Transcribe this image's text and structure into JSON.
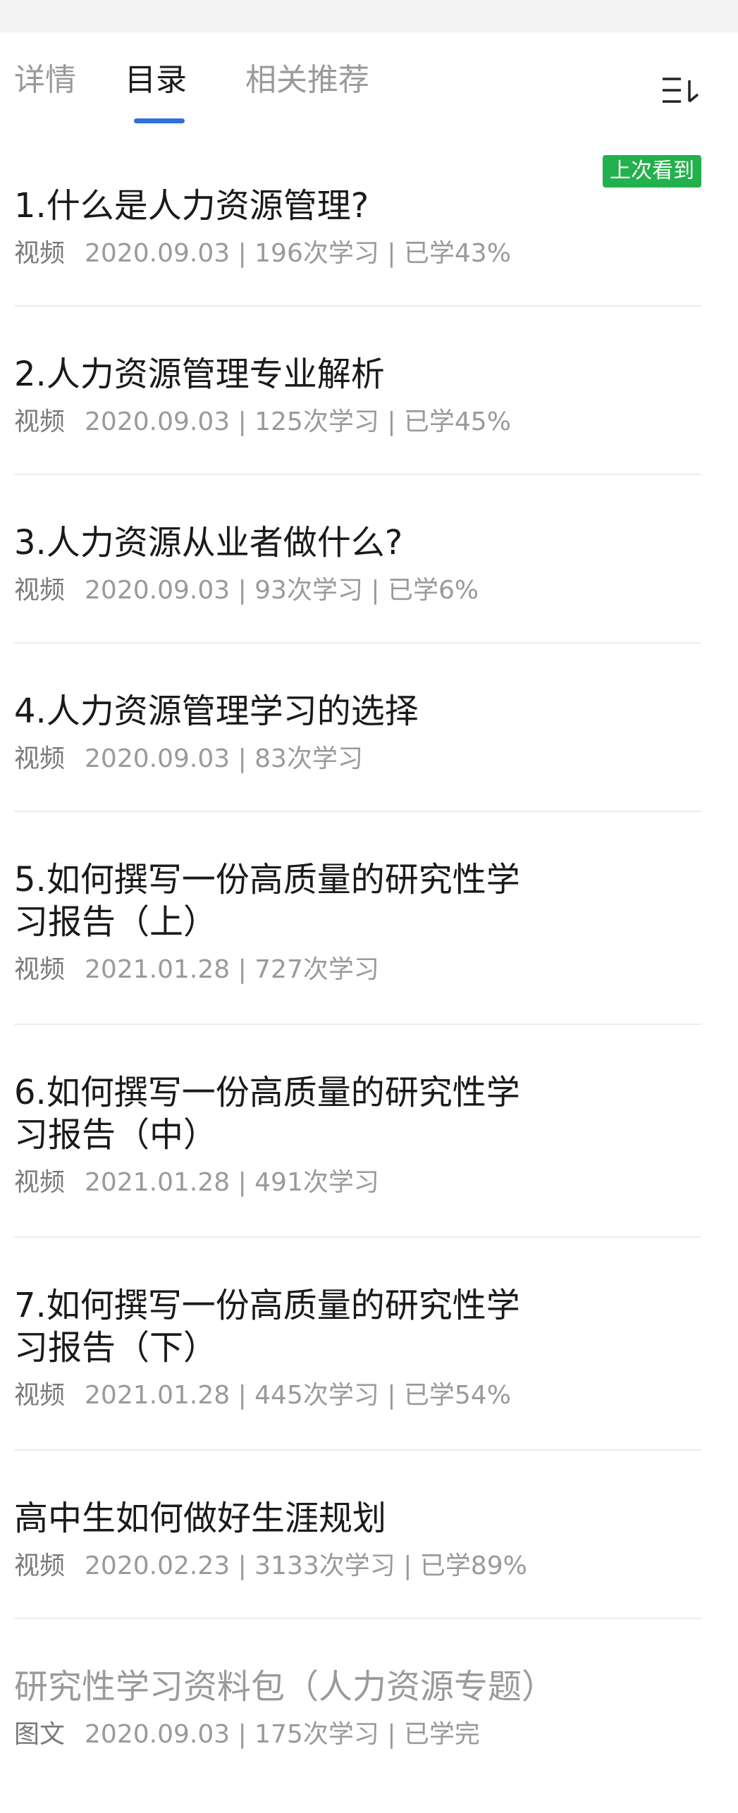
{
  "tabs": [
    {
      "label": "详情"
    },
    {
      "label": "目录"
    },
    {
      "label": "相关推荐"
    }
  ],
  "active_tab": "目录",
  "badge_last_viewed": "上次看到",
  "colors": {
    "accent": "#2f6fde",
    "badge": "#22b14c",
    "text_primary": "#1a1a1a",
    "text_secondary": "#9a9a9a"
  },
  "icons": {
    "sort": "sort-list-icon"
  },
  "items": [
    {
      "title": "1.什么是人力资源管理?",
      "type": "视频",
      "date": "2020.09.03",
      "stats": " | 196次学习 | 已学43%"
    },
    {
      "title": "2.人力资源管理专业解析",
      "type": "视频",
      "date": "2020.09.03",
      "stats": " | 125次学习 | 已学45%"
    },
    {
      "title": "3.人力资源从业者做什么?",
      "type": "视频",
      "date": "2020.09.03",
      "stats": " | 93次学习 | 已学6%"
    },
    {
      "title": "4.人力资源管理学习的选择",
      "type": "视频",
      "date": "2020.09.03",
      "stats": " | 83次学习"
    },
    {
      "title": "5.如何撰写一份高质量的研究性学习报告（上）",
      "type": "视频",
      "date": "2021.01.28",
      "stats": " | 727次学习"
    },
    {
      "title": "6.如何撰写一份高质量的研究性学习报告（中）",
      "type": "视频",
      "date": "2021.01.28",
      "stats": " | 491次学习"
    },
    {
      "title": "7.如何撰写一份高质量的研究性学习报告（下）",
      "type": "视频",
      "date": "2021.01.28",
      "stats": " | 445次学习 | 已学54%"
    },
    {
      "title": "高中生如何做好生涯规划",
      "type": "视频",
      "date": "2020.02.23",
      "stats": " | 3133次学习 | 已学89%"
    },
    {
      "title": "研究性学习资料包（人力资源专题）",
      "type": "图文",
      "date": "2020.09.03",
      "stats": " | 175次学习 | 已学完"
    }
  ]
}
